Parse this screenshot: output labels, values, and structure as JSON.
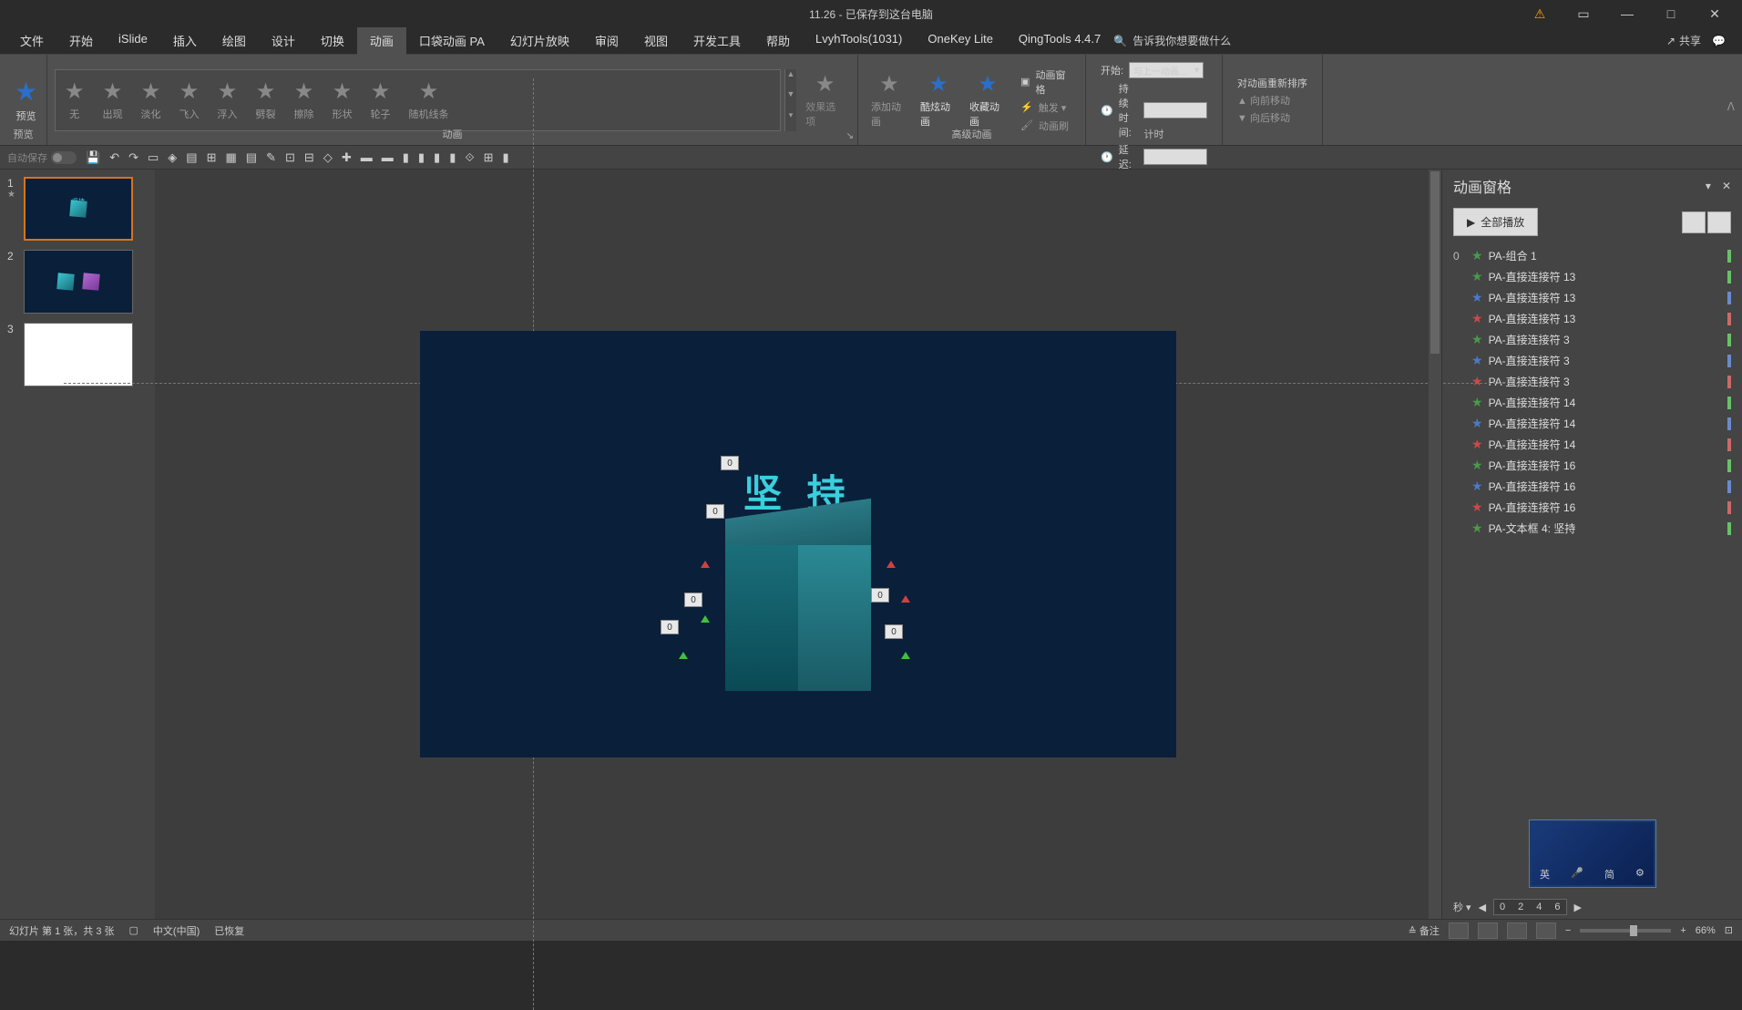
{
  "title": "11.26 - 已保存到这台电脑",
  "menus": [
    "文件",
    "开始",
    "iSlide",
    "插入",
    "绘图",
    "设计",
    "切换",
    "动画",
    "口袋动画 PA",
    "幻灯片放映",
    "审阅",
    "视图",
    "开发工具",
    "帮助",
    "LvyhTools(1031)",
    "OneKey Lite",
    "QingTools 4.4.7"
  ],
  "tellme": "告诉我你想要做什么",
  "share": "共享",
  "ribbon": {
    "preview": {
      "label": "预览",
      "group": "预览"
    },
    "gallery": [
      "无",
      "出现",
      "淡化",
      "飞入",
      "浮入",
      "劈裂",
      "擦除",
      "形状",
      "轮子",
      "随机线条"
    ],
    "gallery_group": "动画",
    "effect_options": "效果选项",
    "add": "添加动画",
    "kuxuan": "酷炫动画",
    "collect": "收藏动画",
    "pane": "动画窗格",
    "trigger": "触发 ▾",
    "painter": "动画刷",
    "adv_group": "高级动画",
    "start_label": "开始:",
    "start_value": "与上一动画...",
    "duration_label": "持续时间:",
    "duration_value": "",
    "delay_label": "延迟:",
    "delay_value": "",
    "reorder_label": "对动画重新排序",
    "move_fwd": "向前移动",
    "move_back": "向后移动",
    "timing_group": "计时"
  },
  "autosave": "自动保存",
  "slide_text": "坚 持",
  "markers": [
    "0",
    "0",
    "0",
    "0",
    "0",
    "0"
  ],
  "pane_title": "动画窗格",
  "play_all": "全部播放",
  "seq": "0",
  "anim_items": [
    {
      "star": "green",
      "label": "PA-组合 1",
      "bar": "#6ac06a"
    },
    {
      "star": "green",
      "label": "PA-直接连接符 13",
      "bar": "#6ac06a"
    },
    {
      "star": "blue",
      "label": "PA-直接连接符 13",
      "bar": "#6a8aca"
    },
    {
      "star": "red",
      "label": "PA-直接连接符 13",
      "bar": "#ca6a6a"
    },
    {
      "star": "green",
      "label": "PA-直接连接符 3",
      "bar": "#6ac06a"
    },
    {
      "star": "blue",
      "label": "PA-直接连接符 3",
      "bar": "#6a8aca"
    },
    {
      "star": "red",
      "label": "PA-直接连接符 3",
      "bar": "#ca6a6a"
    },
    {
      "star": "green",
      "label": "PA-直接连接符 14",
      "bar": "#6ac06a"
    },
    {
      "star": "blue",
      "label": "PA-直接连接符 14",
      "bar": "#6a8aca"
    },
    {
      "star": "red",
      "label": "PA-直接连接符 14",
      "bar": "#ca6a6a"
    },
    {
      "star": "green",
      "label": "PA-直接连接符 16",
      "bar": "#6ac06a"
    },
    {
      "star": "blue",
      "label": "PA-直接连接符 16",
      "bar": "#6a8aca"
    },
    {
      "star": "red",
      "label": "PA-直接连接符 16",
      "bar": "#ca6a6a"
    },
    {
      "star": "green",
      "label": "PA-文本框 4: 坚持",
      "bar": "#6ac06a"
    }
  ],
  "preview_lang": {
    "a": "英",
    "b": "简"
  },
  "timeline_unit": "秒 ▾",
  "timeline_marks": [
    "0",
    "2",
    "4",
    "6"
  ],
  "status": {
    "slide": "幻灯片 第 1 张，共 3 张",
    "lang": "中文(中国)",
    "recovered": "已恢复",
    "notes": "备注",
    "zoom": "66%"
  },
  "thumbs": [
    "1",
    "2",
    "3"
  ]
}
